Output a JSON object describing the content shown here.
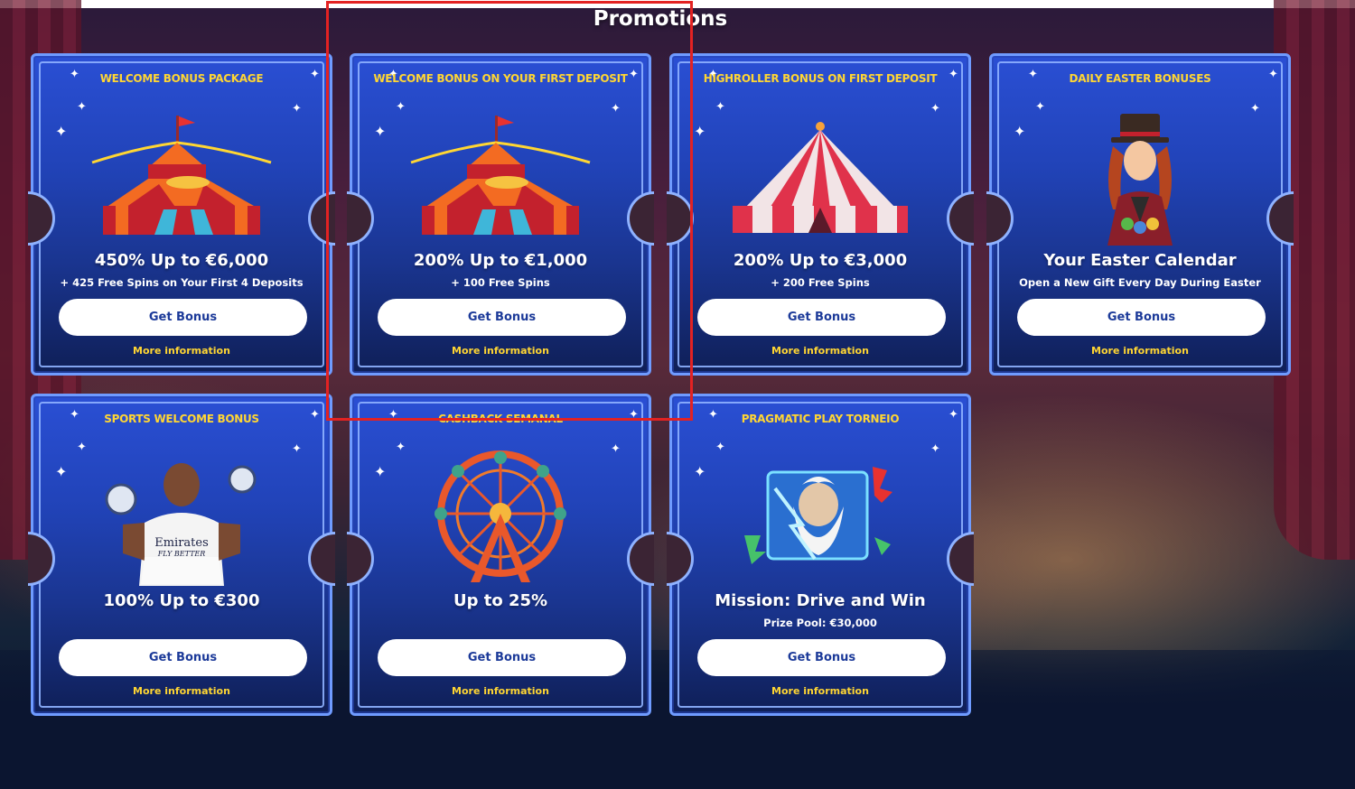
{
  "page": {
    "title": "Promotions"
  },
  "promotions": [
    {
      "title": "WELCOME BONUS PACKAGE",
      "headline": "450% Up to €6,000",
      "subtitle": "+ 425 Free Spins on Your First 4 Deposits",
      "button": "Get Bonus",
      "more": "More information",
      "image": "circus-tent-flags"
    },
    {
      "title": "WELCOME BONUS ON YOUR FIRST DEPOSIT",
      "headline": "200% Up to €1,000",
      "subtitle": "+ 100 Free Spins",
      "button": "Get Bonus",
      "more": "More information",
      "image": "circus-tent-flags"
    },
    {
      "title": "HIGHROLLER BONUS ON FIRST DEPOSIT",
      "headline": "200% Up to €3,000",
      "subtitle": "+ 200 Free Spins",
      "button": "Get Bonus",
      "more": "More information",
      "image": "red-white-tent"
    },
    {
      "title": "DAILY EASTER BONUSES",
      "headline": "Your Easter Calendar",
      "subtitle": "Open a New Gift Every Day During Easter",
      "button": "Get Bonus",
      "more": "More information",
      "image": "ringmaster-woman"
    },
    {
      "title": "SPORTS WELCOME BONUS",
      "headline": "100% Up to €300",
      "subtitle": "",
      "button": "Get Bonus",
      "more": "More information",
      "image": "football-player"
    },
    {
      "title": "CASHBACK SEMANAL",
      "headline": "Up to 25%",
      "subtitle": "",
      "button": "Get Bonus",
      "more": "More information",
      "image": "ferris-wheel"
    },
    {
      "title": "PRAGMATIC PLAY TORNEIO",
      "headline": "Mission: Drive and Win",
      "subtitle": "Prize Pool: €30,000",
      "button": "Get Bonus",
      "more": "More information",
      "image": "zeus-slot"
    }
  ],
  "colors": {
    "accent_yellow": "#ffd633",
    "card_blue": "#2143b8",
    "border_blue": "#6f9bff",
    "button_text": "#1c3a99",
    "highlight_red": "#e32222"
  },
  "player_shirt_text": [
    "Emirates",
    "FLY BETTER"
  ]
}
